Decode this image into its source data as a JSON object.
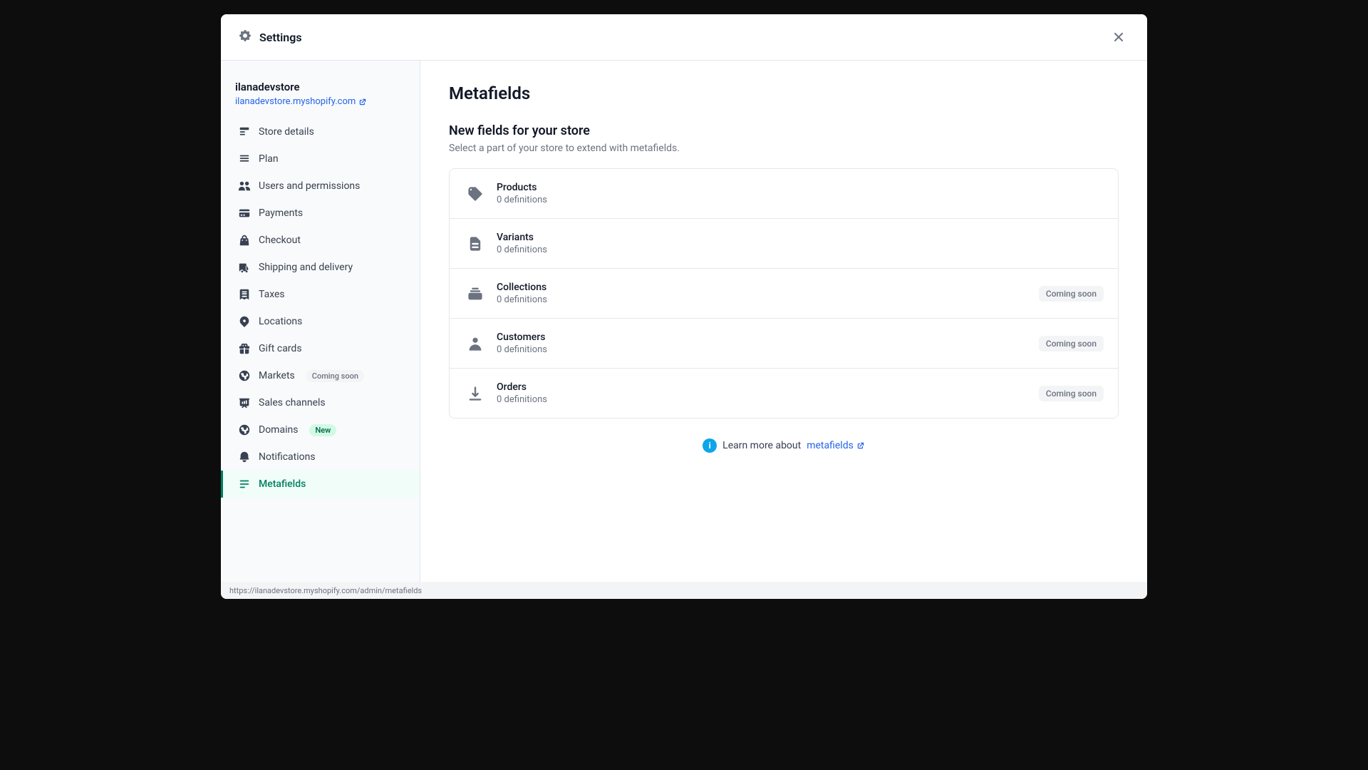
{
  "modal": {
    "title": "Settings",
    "close_label": "×"
  },
  "sidebar": {
    "store_name": "ilanadevstore",
    "store_url": "ilanadevstore.myshopify.com",
    "nav_items": [
      {
        "id": "store-details",
        "label": "Store details",
        "icon": "store"
      },
      {
        "id": "plan",
        "label": "Plan",
        "icon": "plan"
      },
      {
        "id": "users-permissions",
        "label": "Users and permissions",
        "icon": "users"
      },
      {
        "id": "payments",
        "label": "Payments",
        "icon": "payments"
      },
      {
        "id": "checkout",
        "label": "Checkout",
        "icon": "checkout"
      },
      {
        "id": "shipping-delivery",
        "label": "Shipping and delivery",
        "icon": "shipping"
      },
      {
        "id": "taxes",
        "label": "Taxes",
        "icon": "taxes"
      },
      {
        "id": "locations",
        "label": "Locations",
        "icon": "locations"
      },
      {
        "id": "gift-cards",
        "label": "Gift cards",
        "icon": "gift"
      },
      {
        "id": "markets",
        "label": "Markets",
        "icon": "markets",
        "badge": "Coming soon",
        "badge_type": "coming-soon"
      },
      {
        "id": "sales-channels",
        "label": "Sales channels",
        "icon": "sales"
      },
      {
        "id": "domains",
        "label": "Domains",
        "icon": "domains",
        "badge": "New",
        "badge_type": "new"
      },
      {
        "id": "notifications",
        "label": "Notifications",
        "icon": "notifications"
      },
      {
        "id": "metafields",
        "label": "Metafields",
        "icon": "metafields",
        "active": true
      }
    ]
  },
  "main": {
    "page_title": "Metafields",
    "section_title": "New fields for your store",
    "section_subtitle": "Select a part of your store to extend with metafields.",
    "metafield_items": [
      {
        "id": "products",
        "label": "Products",
        "sub": "0 definitions",
        "coming_soon": false
      },
      {
        "id": "variants",
        "label": "Variants",
        "sub": "0 definitions",
        "coming_soon": false
      },
      {
        "id": "collections",
        "label": "Collections",
        "sub": "0 definitions",
        "coming_soon": true
      },
      {
        "id": "customers",
        "label": "Customers",
        "sub": "0 definitions",
        "coming_soon": true
      },
      {
        "id": "orders",
        "label": "Orders",
        "sub": "0 definitions",
        "coming_soon": true
      }
    ],
    "coming_soon_label": "Coming soon",
    "learn_more_text": "Learn more about",
    "learn_more_link": "metafields",
    "learn_more_url": "https://ilanadevstore.myshopify.com/admin/metafields"
  },
  "status_bar": {
    "url": "https://ilanadevstore.myshopify.com/admin/metafields"
  }
}
